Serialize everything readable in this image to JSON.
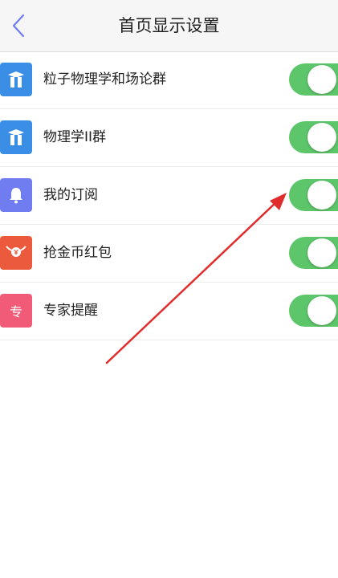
{
  "header": {
    "title": "首页显示设置"
  },
  "items": [
    {
      "label": "粒子物理学和场论群",
      "icon": "group-icon",
      "icon_color": "#3a8ee6",
      "enabled": true
    },
    {
      "label": "物理学II群",
      "icon": "group-icon",
      "icon_color": "#3a8ee6",
      "enabled": true
    },
    {
      "label": "我的订阅",
      "icon": "bell-icon",
      "icon_color": "#6f7df0",
      "enabled": true
    },
    {
      "label": "抢金币红包",
      "icon": "red-envelope-icon",
      "icon_color": "#ec5a3e",
      "enabled": true
    },
    {
      "label": "专家提醒",
      "icon": "expert-icon",
      "icon_glyph": "专",
      "icon_color": "#f25b78",
      "enabled": true
    }
  ],
  "colors": {
    "toggle_on": "#5dc66a",
    "back_arrow": "#6f7df0",
    "annotation_arrow": "#e02c2c"
  }
}
